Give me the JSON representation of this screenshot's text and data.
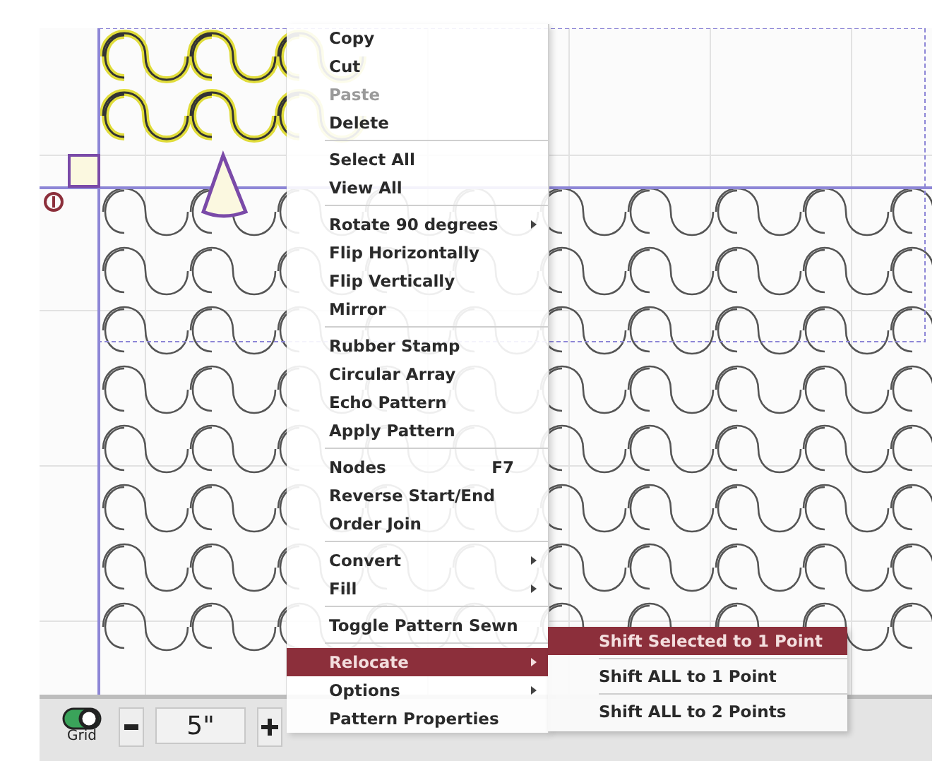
{
  "context_menu": {
    "groups": [
      [
        {
          "label": "Copy",
          "kind": "item",
          "disabled": false,
          "selected": false
        },
        {
          "label": "Cut",
          "kind": "item",
          "disabled": false,
          "selected": false
        },
        {
          "label": "Paste",
          "kind": "item",
          "disabled": true,
          "selected": false
        },
        {
          "label": "Delete",
          "kind": "item",
          "disabled": false,
          "selected": false
        }
      ],
      [
        {
          "label": "Select All",
          "kind": "item",
          "disabled": false,
          "selected": false
        },
        {
          "label": "View All",
          "kind": "item",
          "disabled": false,
          "selected": false
        }
      ],
      [
        {
          "label": "Rotate 90 degrees",
          "kind": "submenu",
          "disabled": false,
          "selected": false
        },
        {
          "label": "Flip Horizontally",
          "kind": "item",
          "disabled": false,
          "selected": false
        },
        {
          "label": "Flip Vertically",
          "kind": "item",
          "disabled": false,
          "selected": false
        },
        {
          "label": "Mirror",
          "kind": "item",
          "disabled": false,
          "selected": false
        }
      ],
      [
        {
          "label": "Rubber Stamp",
          "kind": "item",
          "disabled": false,
          "selected": false
        },
        {
          "label": "Circular Array",
          "kind": "item",
          "disabled": false,
          "selected": false
        },
        {
          "label": "Echo Pattern",
          "kind": "item",
          "disabled": false,
          "selected": false
        },
        {
          "label": "Apply Pattern",
          "kind": "item",
          "disabled": false,
          "selected": false
        }
      ],
      [
        {
          "label": "Nodes",
          "kind": "item",
          "shortcut": "F7",
          "disabled": false,
          "selected": false
        },
        {
          "label": "Reverse Start/End",
          "kind": "item",
          "disabled": false,
          "selected": false
        },
        {
          "label": "Order Join",
          "kind": "item",
          "disabled": false,
          "selected": false
        }
      ],
      [
        {
          "label": "Convert",
          "kind": "submenu",
          "disabled": false,
          "selected": false
        },
        {
          "label": "Fill",
          "kind": "submenu",
          "disabled": false,
          "selected": false
        }
      ],
      [
        {
          "label": "Toggle Pattern Sewn",
          "kind": "item",
          "disabled": false,
          "selected": false
        }
      ],
      [
        {
          "label": "Relocate",
          "kind": "submenu",
          "disabled": false,
          "selected": true
        },
        {
          "label": "Options",
          "kind": "submenu",
          "disabled": false,
          "selected": false
        },
        {
          "label": "Pattern Properties",
          "kind": "item",
          "disabled": false,
          "selected": false
        }
      ]
    ]
  },
  "submenu": {
    "items": [
      {
        "label": "Shift Selected to 1 Point",
        "selected": true
      },
      {
        "label": "Shift ALL to 1 Point",
        "selected": false
      },
      {
        "label": "Shift ALL to 2 Points",
        "selected": false
      }
    ]
  },
  "toolbar": {
    "grid": {
      "label": "Grid",
      "on": true
    },
    "size": {
      "value": "5\""
    }
  }
}
